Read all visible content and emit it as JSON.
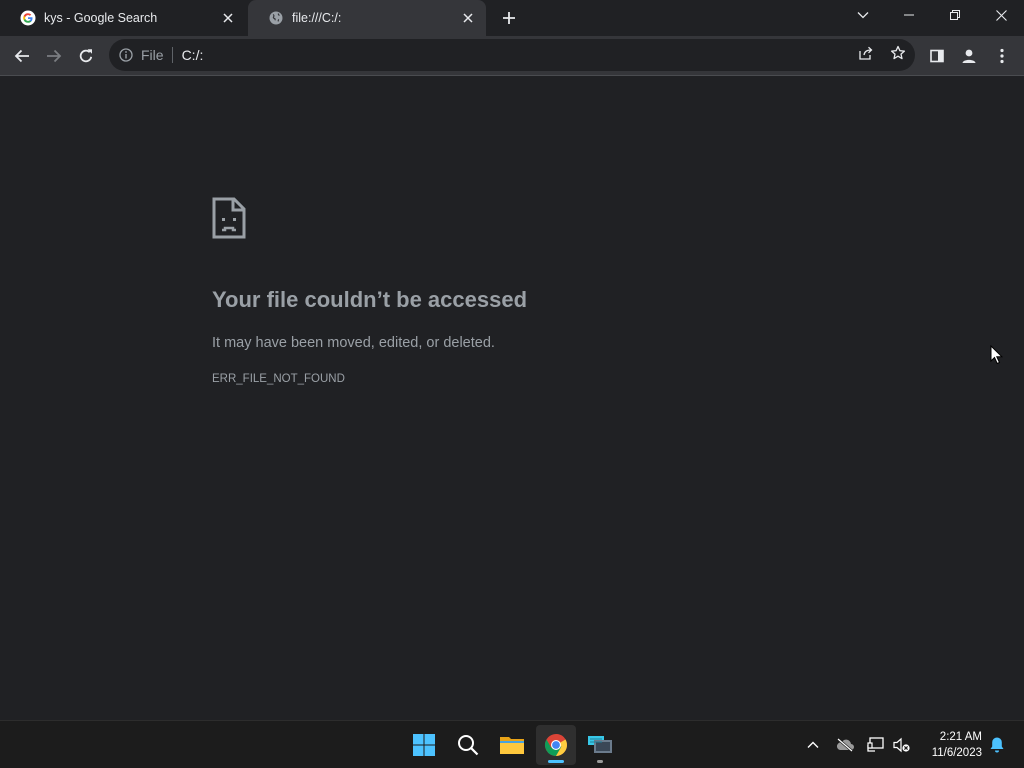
{
  "browser": {
    "tabs": [
      {
        "title": "kys - Google Search",
        "favicon": "google-g-icon",
        "active": false
      },
      {
        "title": "file:///C:/:",
        "favicon": "globe-icon",
        "active": true
      }
    ],
    "omnibox": {
      "scheme": "File",
      "url": "C:/:"
    }
  },
  "error_page": {
    "icon": "sad-file-icon",
    "heading": "Your file couldn’t be accessed",
    "description": "It may have been moved, edited, or deleted.",
    "error_code": "ERR_FILE_NOT_FOUND"
  },
  "taskbar": {
    "apps": [
      "start-icon",
      "search-icon",
      "file-explorer-icon",
      "chrome-icon",
      "touch-keyboard-icon"
    ],
    "clock": {
      "time": "2:21 AM",
      "date": "11/6/2023"
    }
  },
  "colors": {
    "tab_active": "#35363a",
    "background": "#202124",
    "text_muted": "#9aa0a6",
    "accent": "#4cc2ff"
  }
}
